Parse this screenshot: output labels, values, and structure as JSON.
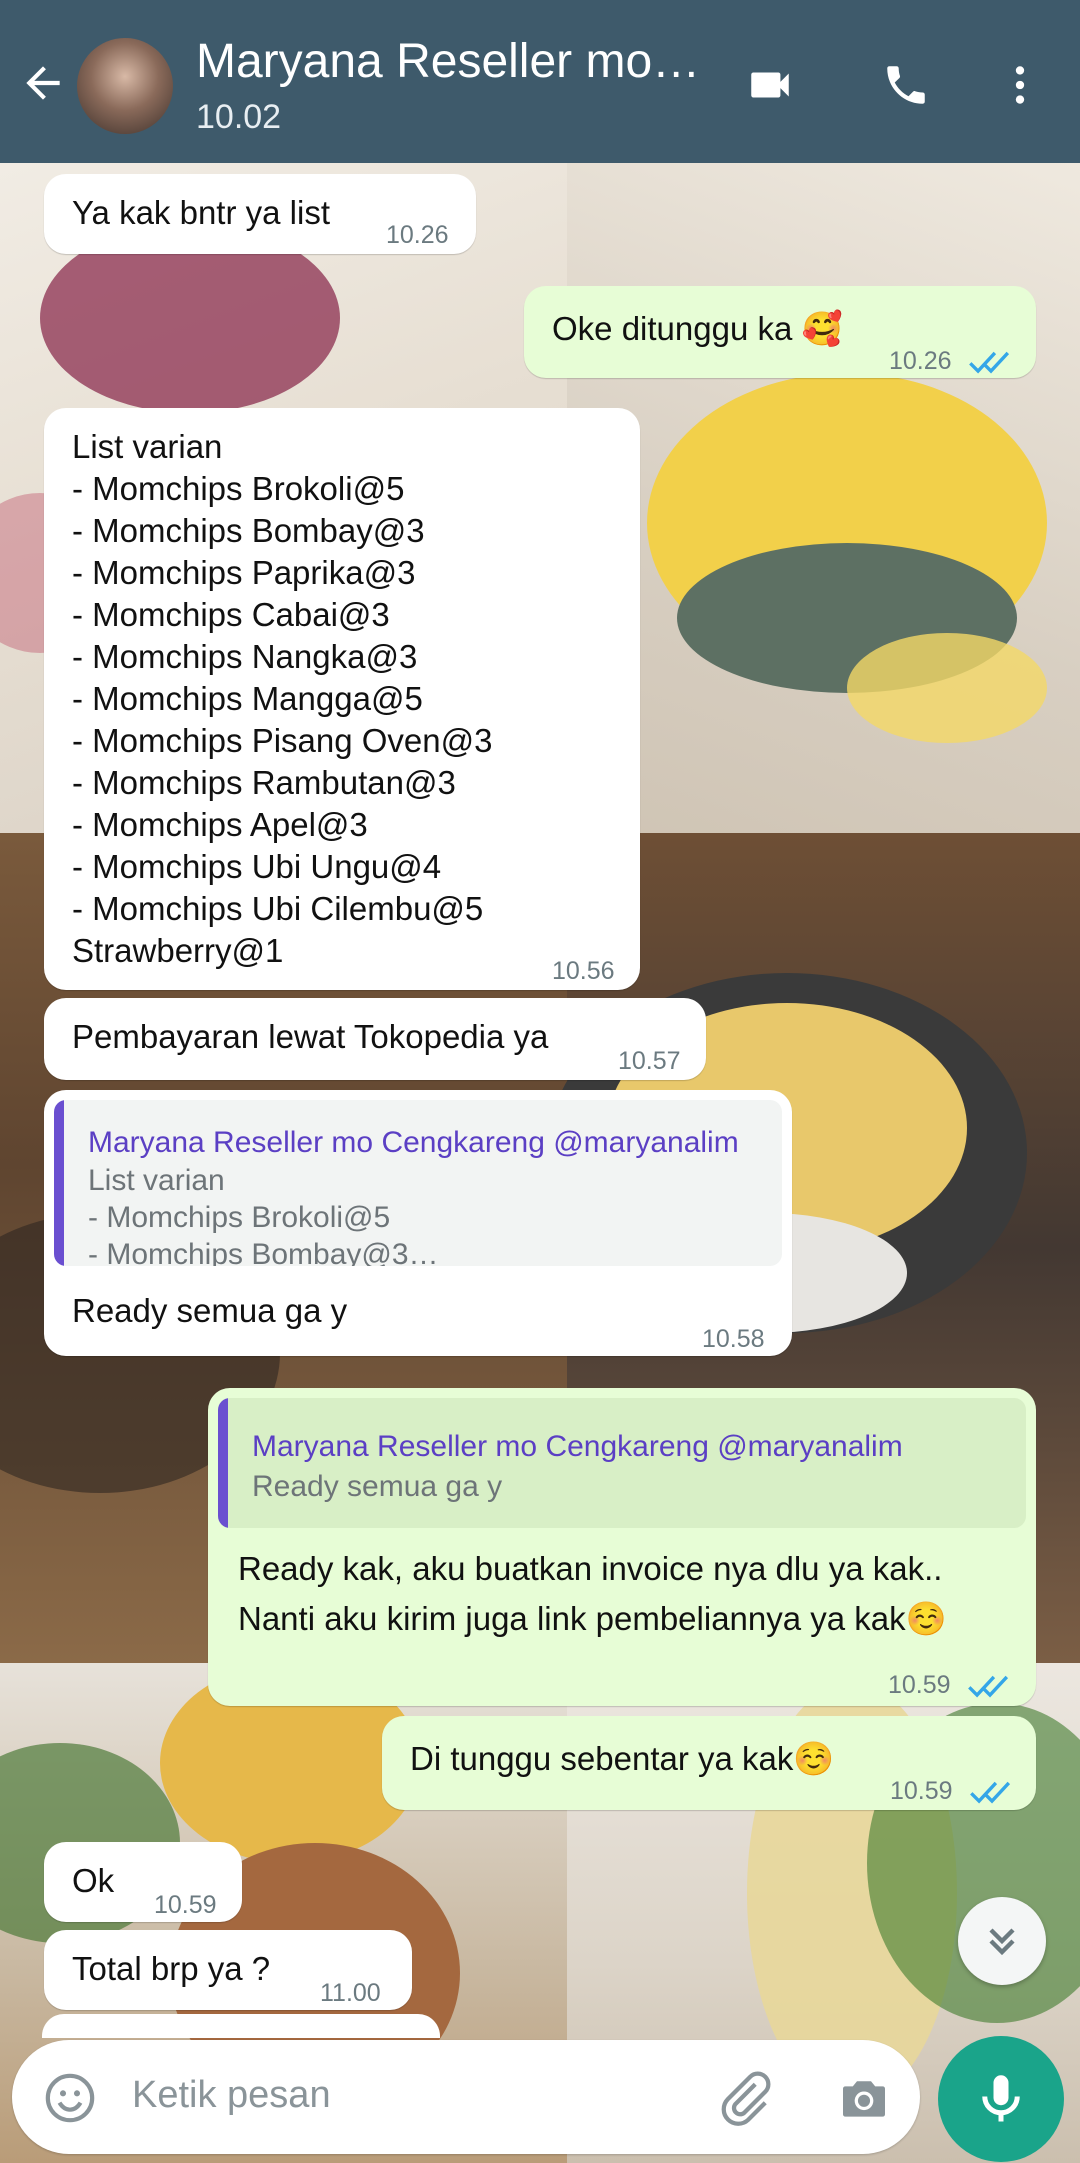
{
  "header": {
    "title": "Maryana Reseller mo…",
    "subtitle": "10.02",
    "bg_color": "#3e5a6b",
    "icons": [
      "back-arrow-icon",
      "avatar",
      "video-call-icon",
      "phone-call-icon",
      "more-options-icon"
    ]
  },
  "messages": [
    {
      "dir": "in",
      "text": "Ya kak bntr ya list",
      "time": "10.26"
    },
    {
      "dir": "out",
      "text": "Oke ditunggu ka 🥰",
      "time": "10.26",
      "status": "read"
    },
    {
      "dir": "in",
      "text": "List varian\n- Momchips Brokoli@5\n- Momchips Bombay@3\n- Momchips Paprika@3\n- Momchips Cabai@3\n- Momchips Nangka@3\n- Momchips Mangga@5\n- Momchips Pisang Oven@3\n- Momchips Rambutan@3\n- Momchips Apel@3\n- Momchips Ubi Ungu@4\n- Momchips Ubi Cilembu@5\nStrawberry@1",
      "time": "10.56"
    },
    {
      "dir": "in",
      "text": "Pembayaran lewat Tokopedia ya",
      "time": "10.57"
    },
    {
      "dir": "in",
      "quote_author": "Maryana Reseller mo Cengkareng @maryanalim",
      "quote_text": "List varian\n- Momchips Brokoli@5\n- Momchips Bombay@3…",
      "text": "Ready semua ga y",
      "time": "10.58"
    },
    {
      "dir": "out",
      "quote_author": "Maryana Reseller mo Cengkareng @maryanalim",
      "quote_text": "Ready semua ga y",
      "text": "Ready kak, aku buatkan invoice nya dlu ya kak..\nNanti aku kirim juga link pembeliannya ya kak☺️",
      "time": "10.59",
      "status": "read"
    },
    {
      "dir": "out",
      "text": "Di tunggu sebentar ya kak☺️",
      "time": "10.59",
      "status": "read"
    },
    {
      "dir": "in",
      "text": "Ok",
      "time": "10.59"
    },
    {
      "dir": "in",
      "text": "Total brp ya ?",
      "time": "11.00"
    }
  ],
  "input": {
    "placeholder": "Ketik pesan",
    "icons": [
      "emoji-icon",
      "attach-icon",
      "camera-icon",
      "mic-icon"
    ]
  },
  "colors": {
    "incoming_bubble": "#ffffff",
    "outgoing_bubble": "#e7fdd6",
    "quote_accent": "#6a4fd0",
    "read_ticks": "#34a6e8",
    "mic_button": "#1aa48a"
  }
}
